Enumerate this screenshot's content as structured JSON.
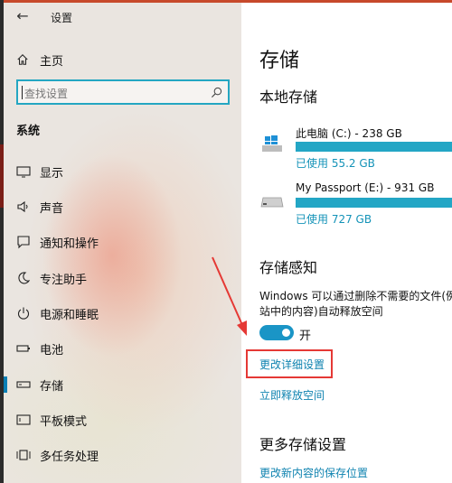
{
  "window": {
    "title": "设置"
  },
  "nav": {
    "home_label": "主页",
    "search_placeholder": "查找设置",
    "section_title": "系统",
    "items": [
      {
        "label": "显示",
        "icon": "display-icon"
      },
      {
        "label": "声音",
        "icon": "sound-icon"
      },
      {
        "label": "通知和操作",
        "icon": "notification-icon"
      },
      {
        "label": "专注助手",
        "icon": "moon-icon"
      },
      {
        "label": "电源和睡眠",
        "icon": "power-icon"
      },
      {
        "label": "电池",
        "icon": "battery-icon"
      },
      {
        "label": "存储",
        "icon": "storage-icon",
        "active": true
      },
      {
        "label": "平板模式",
        "icon": "tablet-icon"
      },
      {
        "label": "多任务处理",
        "icon": "multitask-icon"
      }
    ]
  },
  "main": {
    "title": "存储",
    "local_storage": {
      "heading": "本地存储",
      "drives": [
        {
          "name": "此电脑 (C:) - 238 GB",
          "used": "已使用 55.2 GB",
          "fill": 0.9,
          "icon": "windows-drive-icon"
        },
        {
          "name": "My Passport (E:) - 931 GB",
          "used": "已使用 727 GB",
          "fill": 0.9,
          "icon": "external-drive-icon"
        }
      ]
    },
    "storage_sense": {
      "heading": "存储感知",
      "description_line1": "Windows 可以通过删除不需要的文件(例",
      "description_line2": "站中的内容)自动释放空间",
      "toggle_state": "开",
      "change_settings_link": "更改详细设置",
      "free_space_link": "立即释放空间"
    },
    "more": {
      "heading": "更多存储设置",
      "save_location_link": "更改新内容的保存位置"
    }
  },
  "colors": {
    "accent": "#1a95c6",
    "highlight": "#e53935"
  }
}
